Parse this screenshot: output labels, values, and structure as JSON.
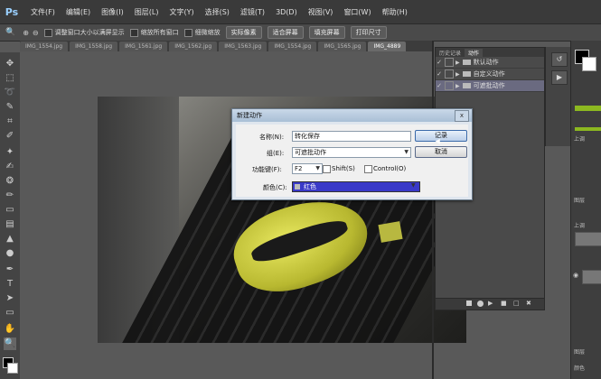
{
  "app": {
    "logo": "Ps"
  },
  "menu": [
    "文件(F)",
    "编辑(E)",
    "图像(I)",
    "图层(L)",
    "文字(Y)",
    "选择(S)",
    "滤镜(T)",
    "3D(D)",
    "视图(V)",
    "窗口(W)",
    "帮助(H)"
  ],
  "options_bar": {
    "checks": [
      "调整窗口大小以满屏显示",
      "缩放所有窗口",
      "细微缩放"
    ],
    "buttons": [
      "实际像素",
      "适合屏幕",
      "填充屏幕",
      "打印尺寸"
    ]
  },
  "doc_tabs": [
    "IMG_1554.jpg",
    "IMG_1558.jpg",
    "IMG_1561.jpg",
    "IMG_1562.jpg",
    "IMG_1563.jpg",
    "IMG_1554.jpg",
    "IMG_1565.jpg",
    "IMG_4889"
  ],
  "actions_panel": {
    "tabs": [
      "历史记录",
      "动作"
    ],
    "items": [
      {
        "label": "默认动作",
        "selected": false
      },
      {
        "label": "自定义动作",
        "selected": false
      },
      {
        "label": "可遮批动作",
        "selected": true
      }
    ]
  },
  "right_panel": {
    "texts": [
      "上调",
      "图层",
      "上调",
      "图层",
      "颜色"
    ]
  },
  "dialog": {
    "title": "新建动作",
    "name_label": "名称(N):",
    "name_value": "转化保存",
    "set_label": "组(E):",
    "set_value": "可遮批动作",
    "fkey_label": "功能键(F):",
    "fkey_value": "F2",
    "shift_label": "Shift(S)",
    "control_label": "Control(O)",
    "color_label": "颜色(C):",
    "color_value": "红色",
    "record_button": "记录",
    "cancel_button": "取消",
    "close_glyph": "x"
  }
}
